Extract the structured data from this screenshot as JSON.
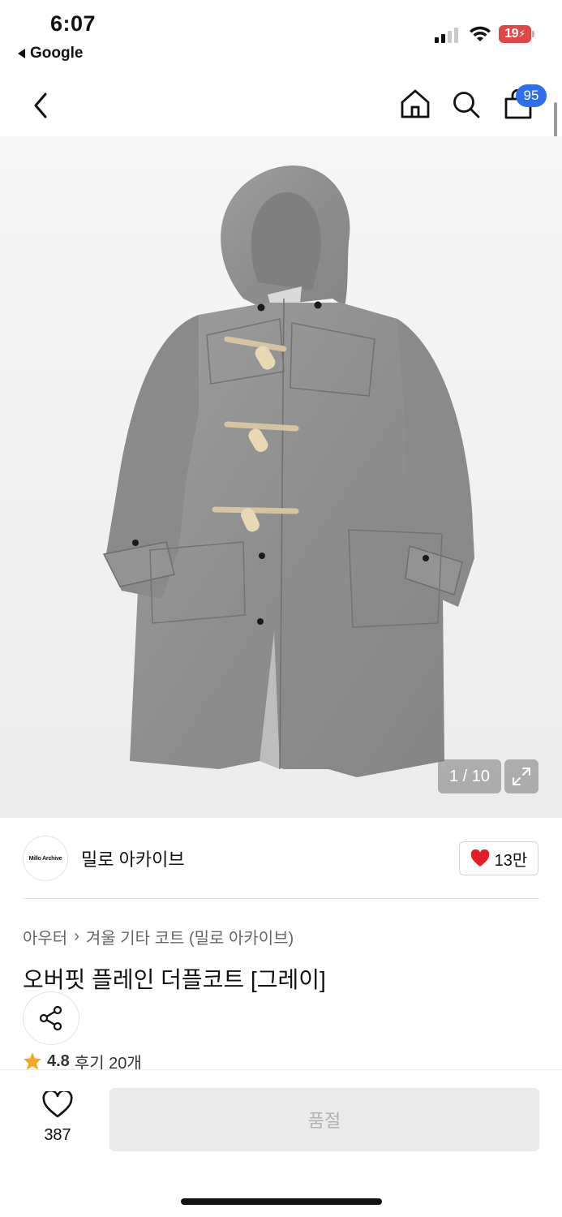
{
  "status_bar": {
    "time": "6:07",
    "back_app": "Google",
    "battery": "19"
  },
  "nav": {
    "cart_count": "95",
    "icons": [
      "back-chevron-icon",
      "home-icon",
      "search-icon",
      "shopping-bag-icon"
    ]
  },
  "gallery": {
    "counter": "1 / 10",
    "expand_icon": "expand-arrows-icon"
  },
  "seller": {
    "logo_text": "Millo Archive",
    "name": "밀로 아카이브",
    "likes": "13만",
    "heart_color": "#e31e24"
  },
  "product": {
    "category": "아우터",
    "subcategory": "겨울 기타 코트 (밀로 아카이브)",
    "title": "오버핏 플레인 더플코트 [그레이]",
    "rating": "4.8",
    "reviews": "후기 20개"
  },
  "bottom_bar": {
    "wish_count": "387",
    "buy_label": "품절"
  },
  "colors": {
    "accent_badge": "#2f6fee",
    "star": "#f5a623",
    "disabled_button": "#ebebeb"
  }
}
